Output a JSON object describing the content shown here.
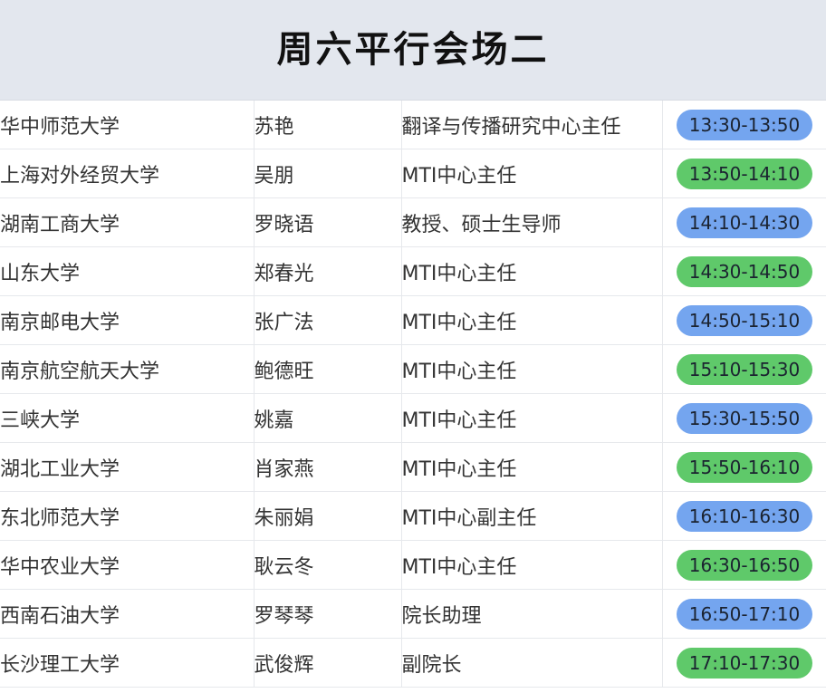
{
  "header": {
    "title": "周六平行会场二"
  },
  "colors": {
    "header_bg": "#e3e7ee",
    "pill_blue": "#74a5ef",
    "pill_green": "#5fc96a"
  },
  "rows": [
    {
      "university": "华中师范大学",
      "name": "苏艳",
      "title": "翻译与传播研究中心主任",
      "time": "13:30-13:50",
      "color": "blue"
    },
    {
      "university": "上海对外经贸大学",
      "name": "吴朋",
      "title": "MTI中心主任",
      "time": "13:50-14:10",
      "color": "green"
    },
    {
      "university": "湖南工商大学",
      "name": "罗晓语",
      "title": "教授、硕士生导师",
      "time": "14:10-14:30",
      "color": "blue"
    },
    {
      "university": "山东大学",
      "name": "郑春光",
      "title": "MTI中心主任",
      "time": "14:30-14:50",
      "color": "green"
    },
    {
      "university": "南京邮电大学",
      "name": "张广法",
      "title": "MTI中心主任",
      "time": "14:50-15:10",
      "color": "blue"
    },
    {
      "university": "南京航空航天大学",
      "name": "鲍德旺",
      "title": "MTI中心主任",
      "time": "15:10-15:30",
      "color": "green"
    },
    {
      "university": "三峡大学",
      "name": "姚嘉",
      "title": "MTI中心主任",
      "time": "15:30-15:50",
      "color": "blue"
    },
    {
      "university": "湖北工业大学",
      "name": "肖家燕",
      "title": "MTI中心主任",
      "time": "15:50-16:10",
      "color": "green"
    },
    {
      "university": "东北师范大学",
      "name": "朱丽娟",
      "title": "MTI中心副主任",
      "time": "16:10-16:30",
      "color": "blue"
    },
    {
      "university": "华中农业大学",
      "name": "耿云冬",
      "title": "MTI中心主任",
      "time": "16:30-16:50",
      "color": "green"
    },
    {
      "university": "西南石油大学",
      "name": "罗琴琴",
      "title": "院长助理",
      "time": "16:50-17:10",
      "color": "blue"
    },
    {
      "university": "长沙理工大学",
      "name": "武俊辉",
      "title": "副院长",
      "time": "17:10-17:30",
      "color": "green"
    }
  ]
}
